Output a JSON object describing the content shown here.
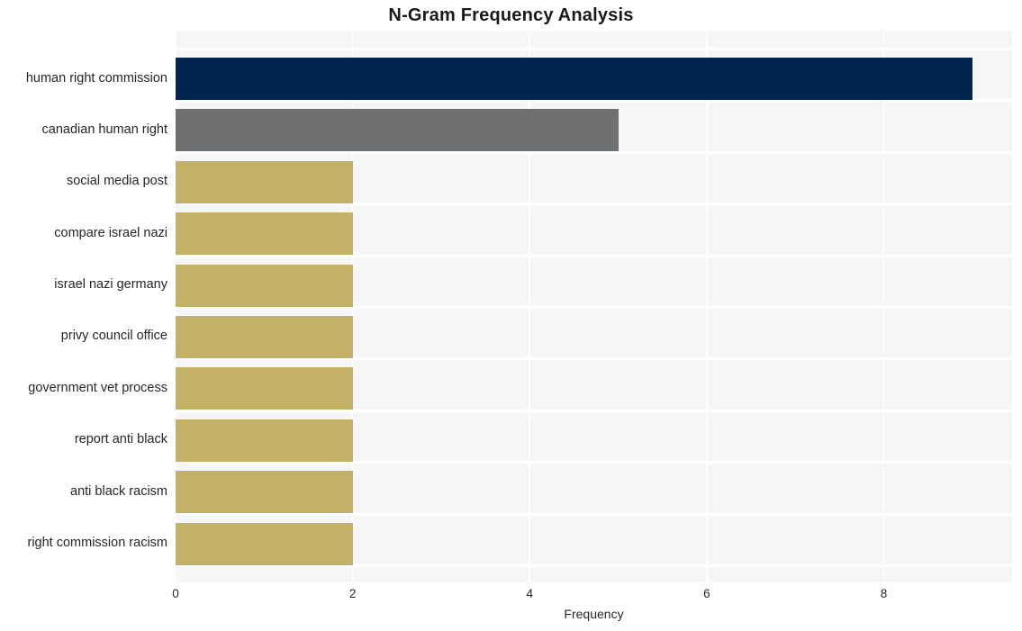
{
  "chart_data": {
    "type": "bar",
    "orientation": "horizontal",
    "title": "N-Gram Frequency Analysis",
    "xlabel": "Frequency",
    "ylabel": "",
    "xlim": [
      0,
      9.45
    ],
    "xticks": [
      0,
      2,
      4,
      6,
      8
    ],
    "xticklabels": [
      "0",
      "2",
      "4",
      "6",
      "8"
    ],
    "grid": true,
    "legend": "none",
    "categories": [
      "human right commission",
      "canadian human right",
      "social media post",
      "compare israel nazi",
      "israel nazi germany",
      "privy council office",
      "government vet process",
      "report anti black",
      "anti black racism",
      "right commission racism"
    ],
    "values": [
      9,
      5,
      2,
      2,
      2,
      2,
      2,
      2,
      2,
      2
    ],
    "bar_colors": [
      "#00254f",
      "#6f7072",
      "#c2b167",
      "#c2b167",
      "#c2b167",
      "#c2b167",
      "#c2b167",
      "#c2b167",
      "#c2b167",
      "#c2b167"
    ]
  },
  "style": {
    "plot_background": "#f6f6f7",
    "grid_color": "#ffffff",
    "page_background": "#ffffff",
    "text_color": "#262626",
    "title_color": "#1a1a1a"
  }
}
